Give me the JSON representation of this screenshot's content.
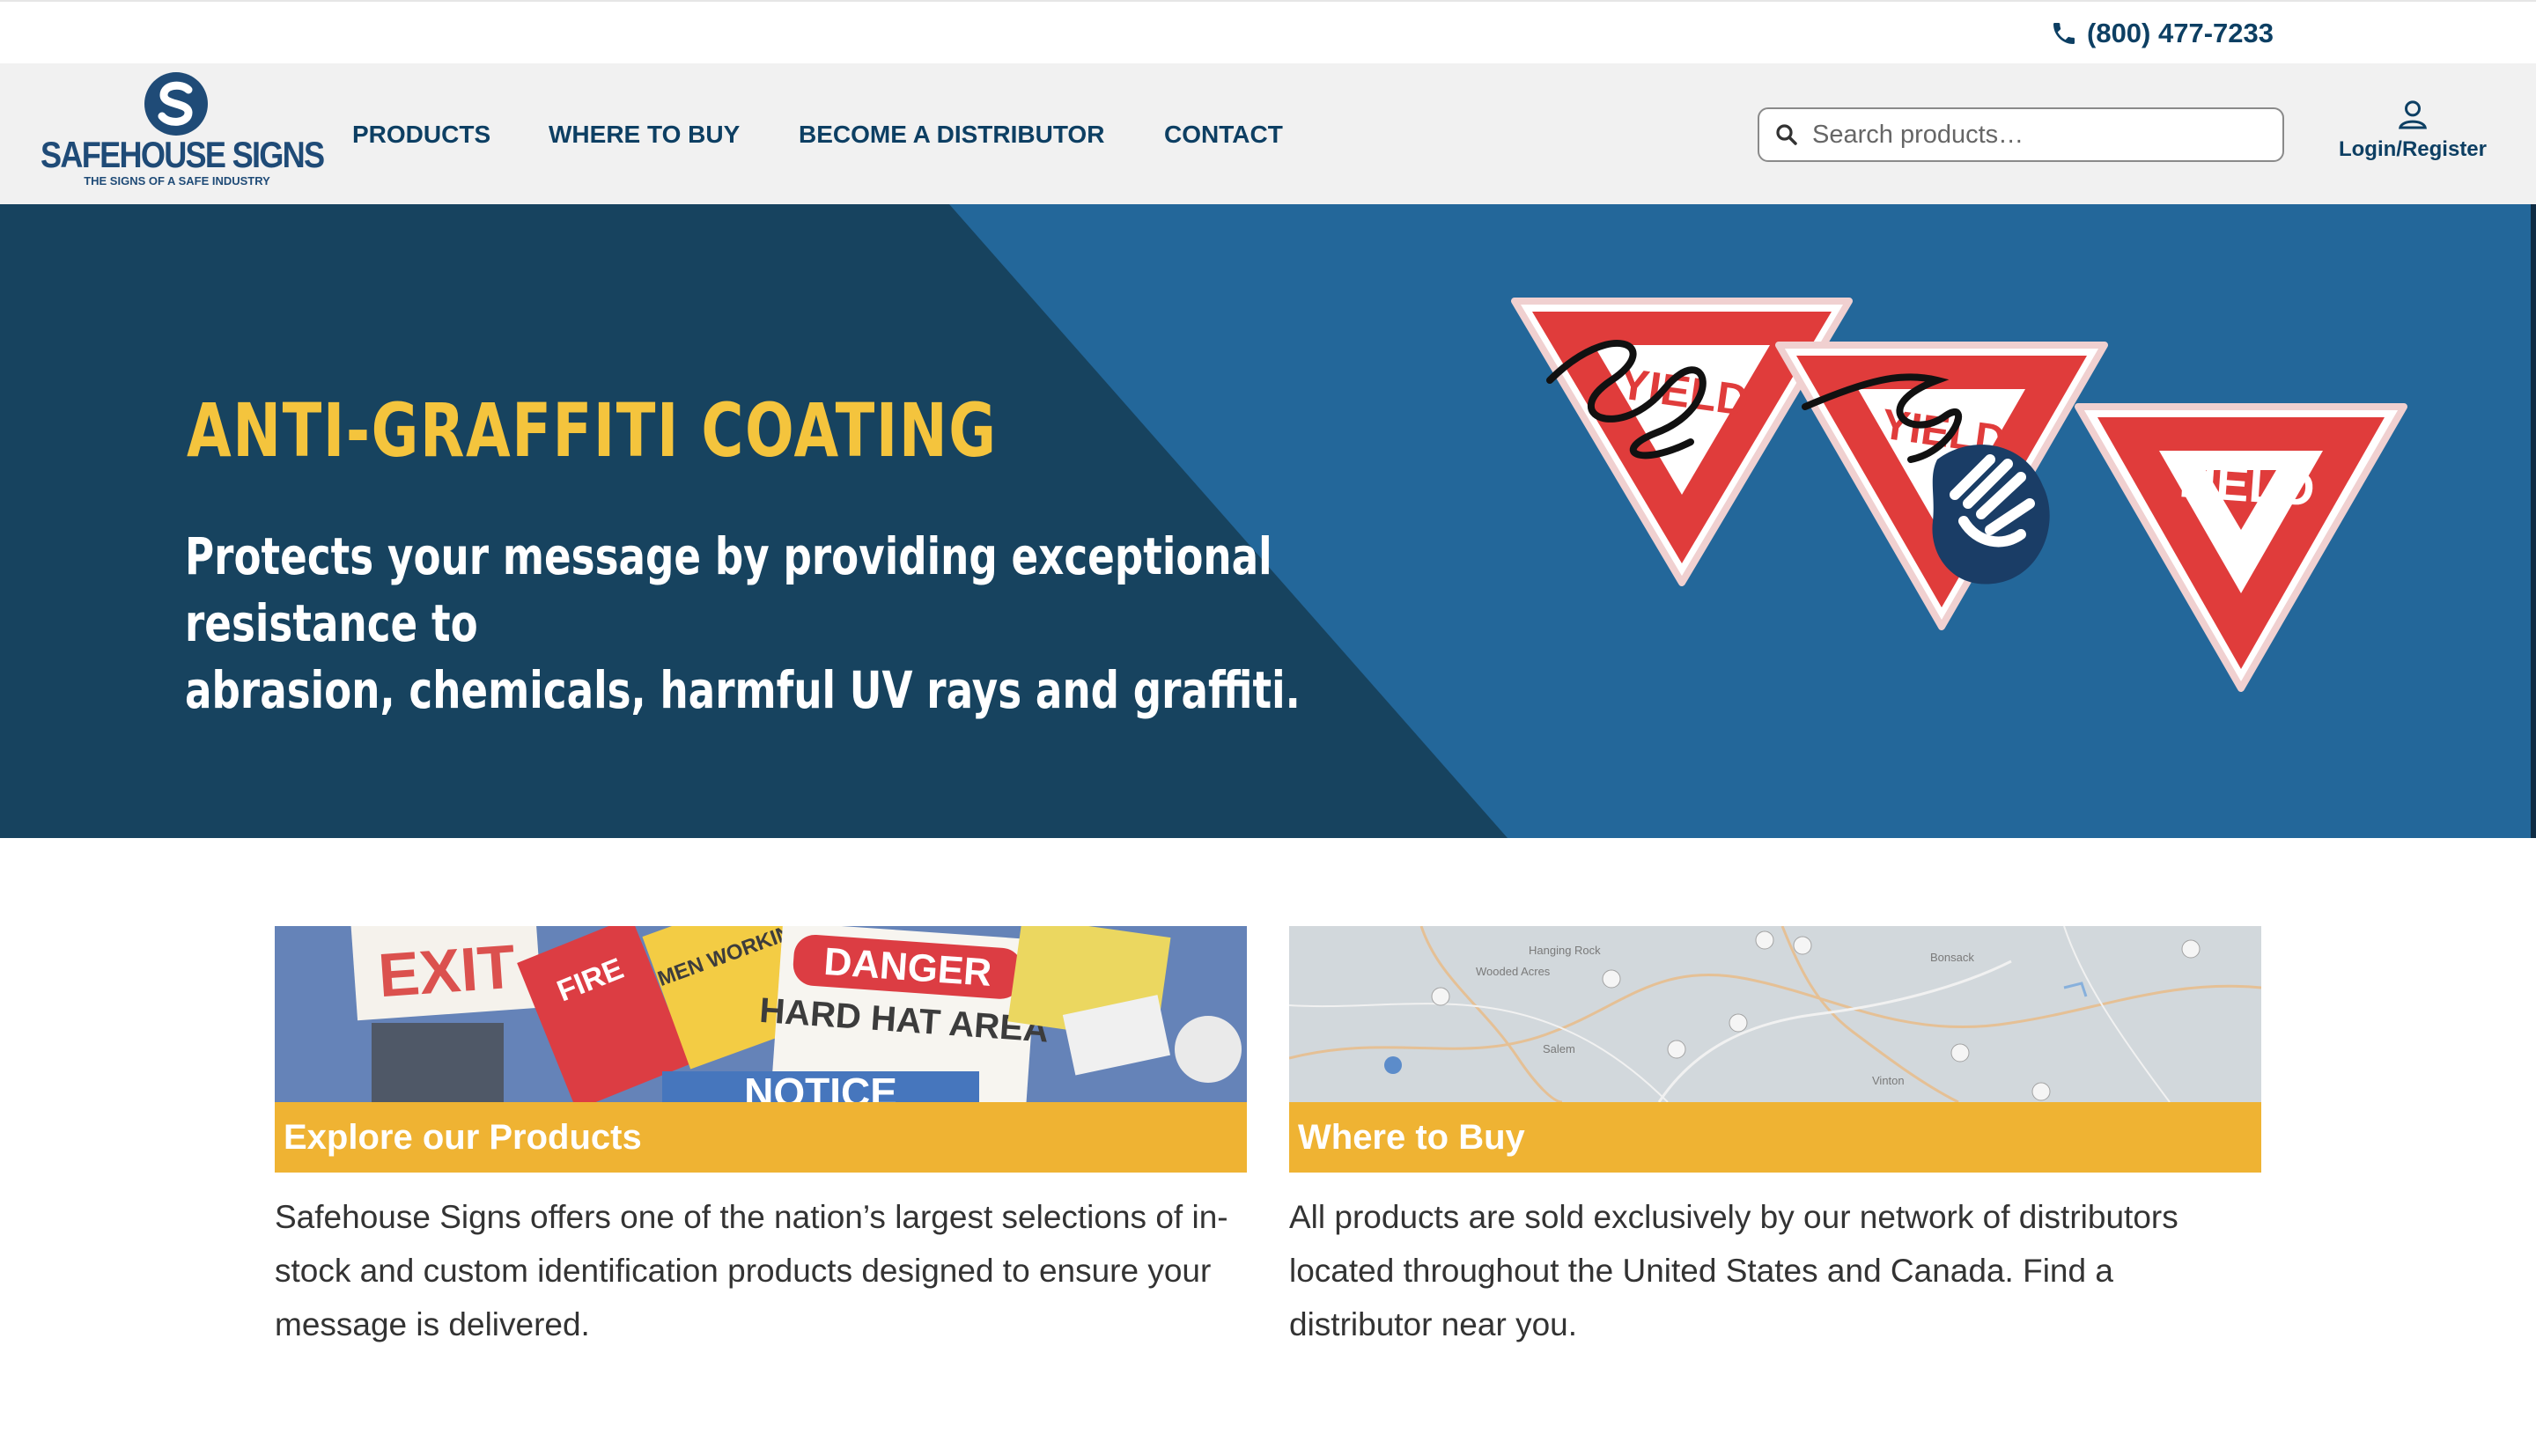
{
  "topbar": {
    "phone": "(800) 477-7233"
  },
  "logo": {
    "name": "SAFEHOUSE SIGNS",
    "tagline": "THE SIGNS OF A SAFE INDUSTRY"
  },
  "nav": [
    {
      "label": "PRODUCTS"
    },
    {
      "label": "WHERE TO BUY"
    },
    {
      "label": "BECOME A DISTRIBUTOR"
    },
    {
      "label": "CONTACT"
    }
  ],
  "search": {
    "placeholder": "Search products…",
    "value": ""
  },
  "account": {
    "label": "Login/Register"
  },
  "hero": {
    "title": "ANTI-GRAFFITI COATING",
    "subtitle_line1": "Protects your message by providing exceptional resistance to",
    "subtitle_line2": "abrasion, chemicals, harmful UV rays and graffiti.",
    "sign_text": "YIELD"
  },
  "cards": [
    {
      "title": "Explore our Products",
      "text": "Safehouse Signs offers one of the nation’s largest selections of in-stock and custom identification products designed to ensure your message is delivered.",
      "image_signs": [
        "EXIT",
        "FIRE",
        "DANGER",
        "HARD HAT AREA",
        "NOTICE",
        "MEN WORKING"
      ]
    },
    {
      "title": "Where to Buy",
      "text": "All products are sold exclusively by our network of distributors located throughout the United States and Canada. Find a distributor near you.",
      "map_labels": [
        "Hanging Rock",
        "Wooded Acres",
        "Bonsack",
        "Salem",
        "Vinton"
      ]
    }
  ],
  "colors": {
    "navy": "#0d3f63",
    "hero_dark": "#17435f",
    "hero_light": "#23679a",
    "yellow": "#f4c43d",
    "card_band": "#efb333",
    "sign_red": "#e03c3b"
  }
}
